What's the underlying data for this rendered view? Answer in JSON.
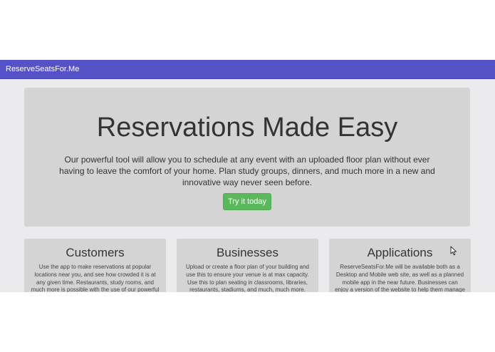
{
  "navbar": {
    "brand": "ReserveSeatsFor.Me"
  },
  "hero": {
    "title": "Reservations Made Easy",
    "text": "Our powerful tool will allow you to schedule at any event with an uploaded floor plan without ever having to leave the comfort of your home. Plan study groups, dinners, and much more in a new and innovative way never seen before.",
    "button_label": "Try it today"
  },
  "cards": [
    {
      "title": "Customers",
      "text": "Use the app to make reservations at popular locations near you, and see how crowded it is at any given time. Restaurants, study rooms, and much more is possible with the use of our powerful"
    },
    {
      "title": "Businesses",
      "text": "Upload or create a floor plan of your building and use this to ensure your venue is at max capacity. Use this to plan seating in classrooms, libraries, restaurants, stadiums, and much, much more."
    },
    {
      "title": "Applications",
      "text": "ReserveSeatsFor.Me will be available both as a Desktop and Mobile web site, as well as a planned mobile app in the near future. Businesses can enjoy a version of the website to help them manage their"
    }
  ],
  "colors": {
    "navbar": "#5552c8",
    "button": "#5cb85c",
    "panel": "#d4d4d4",
    "background": "#ebebee"
  },
  "icons": {
    "cursor": "mouse-pointer-icon"
  }
}
